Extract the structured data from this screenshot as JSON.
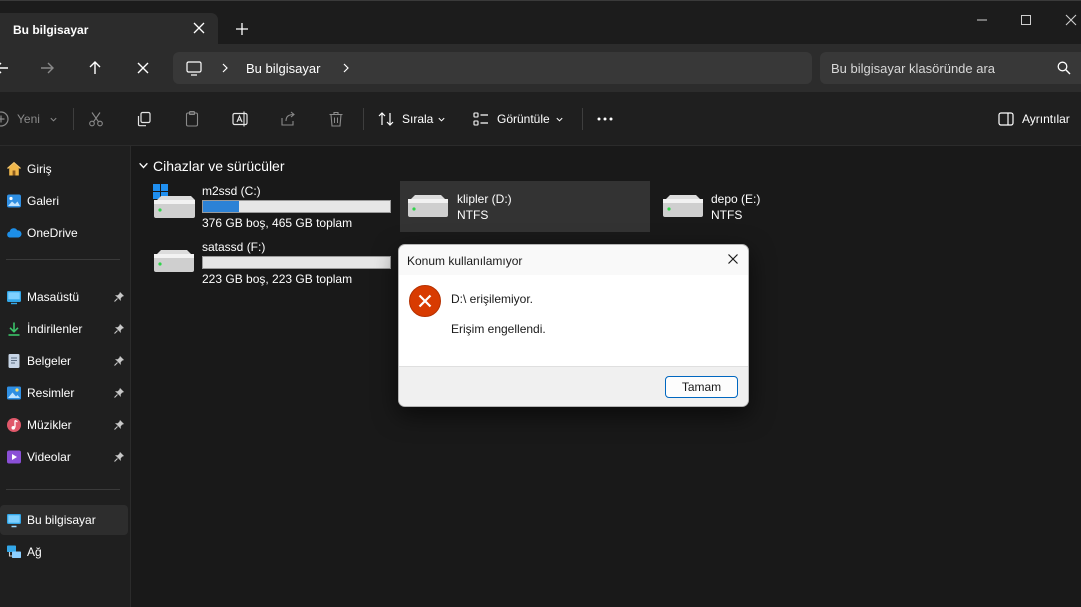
{
  "window": {
    "tab_title": "Bu bilgisayar",
    "new_tab_glyph": "+"
  },
  "nav": {
    "breadcrumb": "Bu bilgisayar",
    "search_placeholder": "Bu bilgisayar klasöründe ara"
  },
  "toolbar": {
    "new_label": "Yeni",
    "sort_label": "Sırala",
    "view_label": "Görüntüle",
    "details_label": "Ayrıntılar"
  },
  "sidebar": {
    "items": [
      {
        "label": "Giriş",
        "icon": "home-icon"
      },
      {
        "label": "Galeri",
        "icon": "gallery-icon"
      },
      {
        "label": "OneDrive",
        "icon": "onedrive-icon"
      },
      {
        "label": "Masaüstü",
        "icon": "desktop-icon",
        "pinned": true
      },
      {
        "label": "İndirilenler",
        "icon": "download-icon",
        "pinned": true
      },
      {
        "label": "Belgeler",
        "icon": "documents-icon",
        "pinned": true
      },
      {
        "label": "Resimler",
        "icon": "pictures-icon",
        "pinned": true
      },
      {
        "label": "Müzikler",
        "icon": "music-icon",
        "pinned": true
      },
      {
        "label": "Videolar",
        "icon": "videos-icon",
        "pinned": true
      },
      {
        "label": "Bu bilgisayar",
        "icon": "this-pc-icon",
        "active": true
      },
      {
        "label": "Ağ",
        "icon": "network-icon"
      }
    ]
  },
  "main": {
    "section_title": "Cihazlar ve sürücüler",
    "drives": [
      {
        "name": "m2ssd (C:)",
        "detail": "376 GB boş, 465 GB toplam",
        "used_fraction": 0.19
      },
      {
        "name": "klipler (D:)",
        "detail": "NTFS"
      },
      {
        "name": "depo (E:)",
        "detail": "NTFS"
      },
      {
        "name": "satassd (F:)",
        "detail": "223 GB boş, 223 GB toplam",
        "used_fraction": 0.0
      }
    ]
  },
  "dialog": {
    "title": "Konum kullanılamıyor",
    "message": "D:\\ erişilemiyor.",
    "detail": "Erişim engellendi.",
    "ok_label": "Tamam"
  },
  "colors": {
    "accent": "#0067c0",
    "storage_bar": "#2c82d6",
    "error_icon": "#d83b01"
  }
}
